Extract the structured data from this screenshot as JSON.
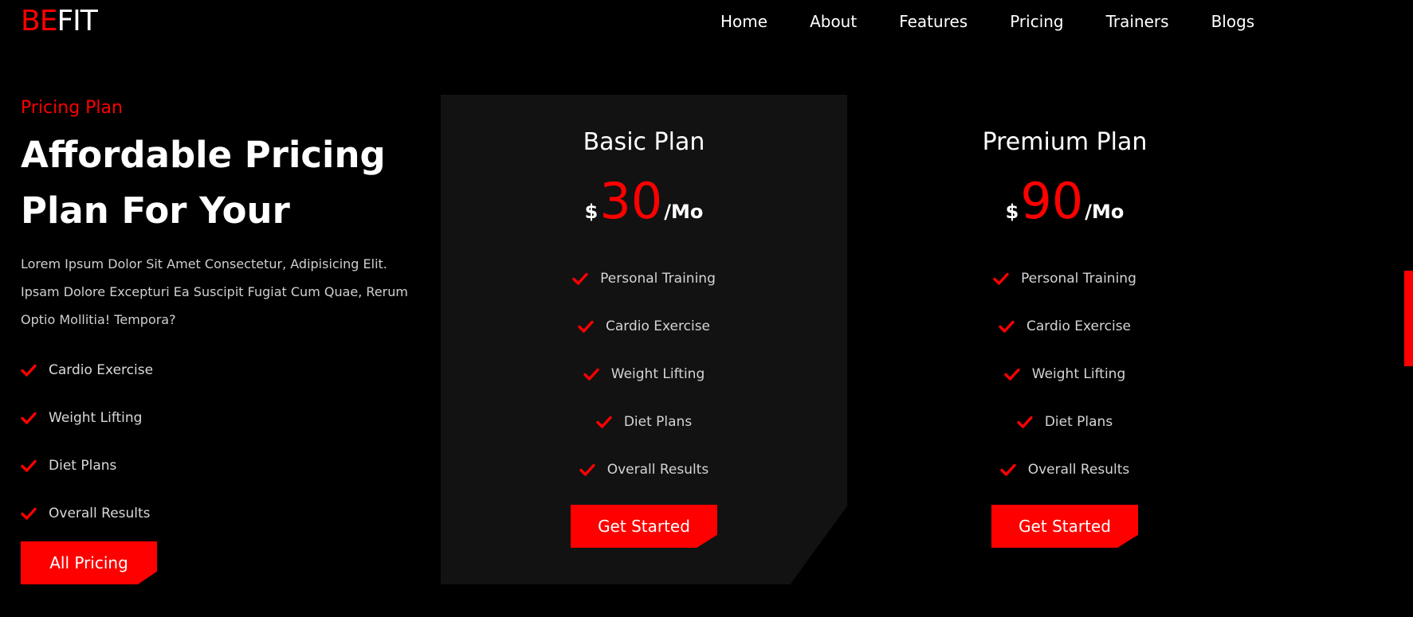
{
  "brand": {
    "part1": "BE",
    "part2": "FIT",
    "accent": "#ff0000"
  },
  "nav": [
    {
      "label": "Home"
    },
    {
      "label": "About"
    },
    {
      "label": "Features"
    },
    {
      "label": "Pricing"
    },
    {
      "label": "Trainers"
    },
    {
      "label": "Blogs"
    }
  ],
  "intro": {
    "eyebrow": "Pricing Plan",
    "headline": "Affordable Pricing Plan For Your",
    "description": "Lorem Ipsum Dolor Sit Amet Consectetur, Adipisicing Elit. Ipsam Dolore Excepturi Ea Suscipit Fugiat Cum Quae, Rerum Optio Mollitia! Tempora?",
    "features": [
      "Cardio Exercise",
      "Weight Lifting",
      "Diet Plans",
      "Overall Results"
    ],
    "button_label": "All Pricing"
  },
  "plans": [
    {
      "title": "Basic Plan",
      "currency": "$",
      "amount": "30",
      "period": "/Mo",
      "features": [
        "Personal Training",
        "Cardio Exercise",
        "Weight Lifting",
        "Diet Plans",
        "Overall Results"
      ],
      "button_label": "Get Started"
    },
    {
      "title": "Premium Plan",
      "currency": "$",
      "amount": "90",
      "period": "/Mo",
      "features": [
        "Personal Training",
        "Cardio Exercise",
        "Weight Lifting",
        "Diet Plans",
        "Overall Results"
      ],
      "button_label": "Get Started"
    }
  ],
  "icons": {
    "check": "check-icon"
  }
}
